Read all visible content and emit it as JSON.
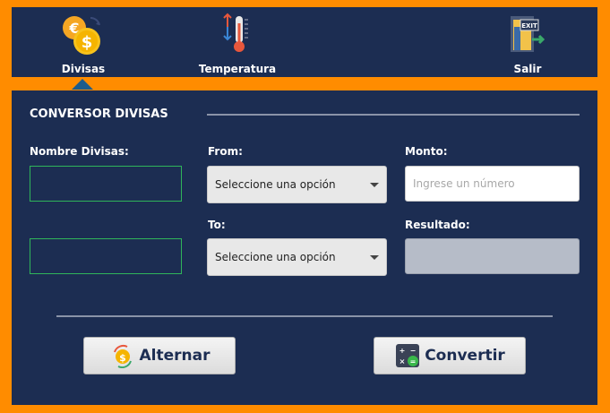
{
  "nav": {
    "divisas": "Divisas",
    "temperatura": "Temperatura",
    "salir": "Salir",
    "exit_sign": "EXIT"
  },
  "panel": {
    "title": "CONVERSOR DIVISAS",
    "nombre_label": "Nombre Divisas:",
    "from_label": "From:",
    "to_label": "To:",
    "monto_label": "Monto:",
    "resultado_label": "Resultado:",
    "from_select": "Seleccione una opción",
    "to_select": "Seleccione una opción",
    "monto_placeholder": "Ingrese un número"
  },
  "buttons": {
    "alternar": "Alternar",
    "convertir": "Convertir"
  },
  "colors": {
    "frame": "#ff8c00",
    "panel": "#1c2d52",
    "accent_green": "#2fb55a"
  }
}
